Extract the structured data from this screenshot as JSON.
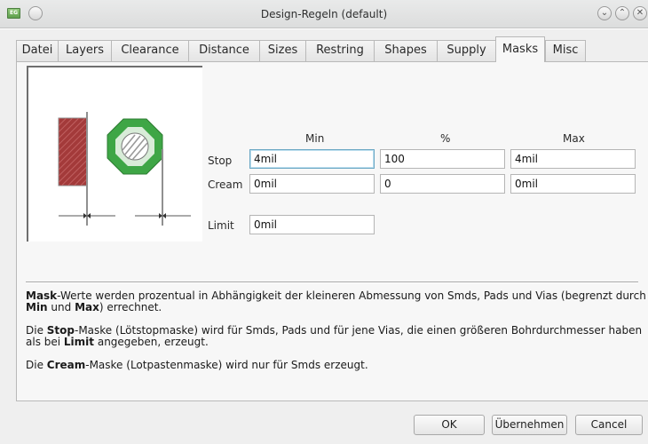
{
  "window": {
    "title": "Design-Regeln (default)",
    "app_icon": "eagle-app-icon",
    "controls": [
      "minimize",
      "maximize",
      "close"
    ],
    "control_glyphs": {
      "minimize": "⌄",
      "maximize": "⌃",
      "close": "✕"
    }
  },
  "tabs": [
    {
      "label": "Datei"
    },
    {
      "label": "Layers"
    },
    {
      "label": "Clearance"
    },
    {
      "label": "Distance"
    },
    {
      "label": "Sizes"
    },
    {
      "label": "Restring"
    },
    {
      "label": "Shapes"
    },
    {
      "label": "Supply"
    },
    {
      "label": "Masks",
      "active": true
    },
    {
      "label": "Misc"
    }
  ],
  "masks": {
    "headers": {
      "min": "Min",
      "percent": "%",
      "max": "Max"
    },
    "stop": {
      "label": "Stop",
      "min": "4mil",
      "percent": "100",
      "max": "4mil"
    },
    "cream": {
      "label": "Cream",
      "min": "0mil",
      "percent": "0",
      "max": "0mil"
    },
    "limit": {
      "label": "Limit",
      "value": "0mil"
    }
  },
  "description": {
    "p1": [
      {
        "b": "Mask"
      },
      {
        "t": "-Werte werden prozentual in Abhängigkeit der kleineren Abmessung von Smds, Pads und Vias (begrenzt durch "
      },
      {
        "b": "Min"
      },
      {
        "t": " und "
      },
      {
        "b": "Max"
      },
      {
        "t": ") errechnet."
      }
    ],
    "p2": [
      {
        "t": "Die "
      },
      {
        "b": "Stop"
      },
      {
        "t": "-Maske (Lötstopmaske) wird für Smds, Pads und für jene Vias, die einen größeren Bohrdurchmesser haben als bei "
      },
      {
        "b": "Limit"
      },
      {
        "t": " angegeben, erzeugt."
      }
    ],
    "p3": [
      {
        "t": "Die "
      },
      {
        "b": "Cream"
      },
      {
        "t": "-Maske (Lotpastenmaske) wird nur für Smds erzeugt."
      }
    ]
  },
  "buttons": {
    "ok": "OK",
    "apply": "Übernehmen",
    "cancel": "Cancel"
  },
  "colors": {
    "smd_red": "#a33a3a",
    "pad_green": "#3ea646",
    "focus_blue": "#6aa7c4"
  }
}
